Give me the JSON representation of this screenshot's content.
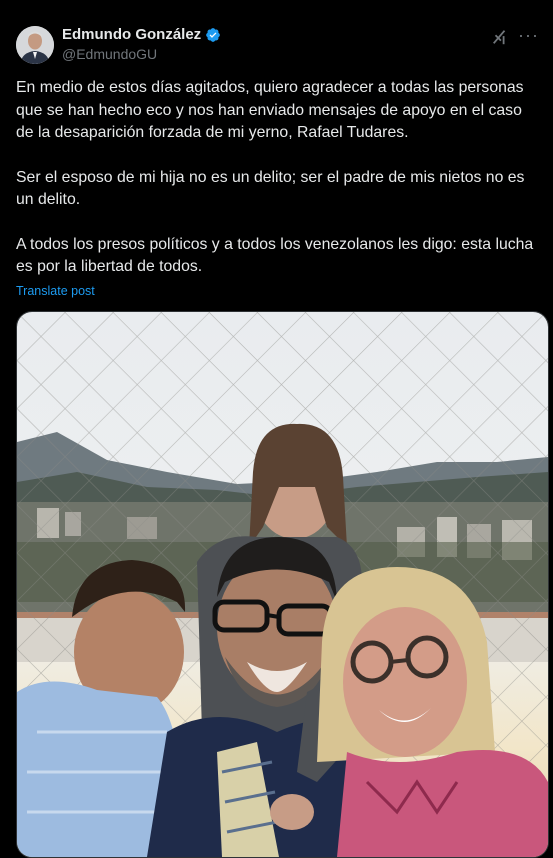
{
  "author": {
    "display_name": "Edmundo González",
    "handle": "@EdmundoGU",
    "verified_icon": "verified-badge-icon"
  },
  "post": {
    "paragraphs": [
      "En medio de estos días agitados, quiero agradecer a todas las personas que se han hecho eco y nos han enviado mensajes de apoyo en el caso de la desaparición forzada de mi yerno, Rafael Tudares.",
      "Ser el esposo de mi hija no es un delito; ser el padre de mis nietos no es un delito.",
      "A todos los presos políticos y a todos los venezolanos les digo: esta lucha es por la libertad de todos."
    ],
    "translate_label": "Translate post"
  },
  "actions": {
    "grok_icon": "grok-icon",
    "more_icon": "more-icon",
    "more_label": "···"
  },
  "colors": {
    "background": "#000000",
    "text": "#e7e9ea",
    "muted": "#71767b",
    "accent": "#1d9bf0"
  }
}
